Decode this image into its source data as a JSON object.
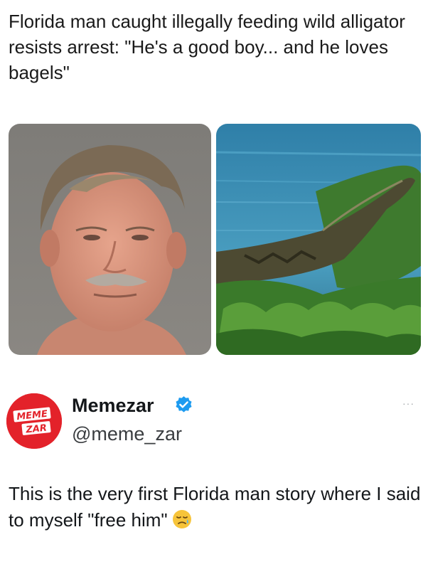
{
  "headline": "Florida man caught illegally feeding wild alligator resists arrest: \"He's a good boy... and he loves bagels\"",
  "images": {
    "left": "mugshot-photo",
    "right": "alligator-photo"
  },
  "author": {
    "display_name": "Memezar",
    "handle": "@meme_zar",
    "avatar_line1": "MEME",
    "avatar_line2": "ZAR",
    "verified_icon": "verified-badge-icon",
    "more_icon": "more-options-icon",
    "more_label": "···"
  },
  "tweet": {
    "text": "This is the very first Florida man story where I said to myself \"free him\"",
    "emoji": "sad-relieved-face-emoji"
  },
  "colors": {
    "avatar_red": "#e3222a",
    "verified_blue": "#1d9bf0",
    "text": "#14171a"
  }
}
